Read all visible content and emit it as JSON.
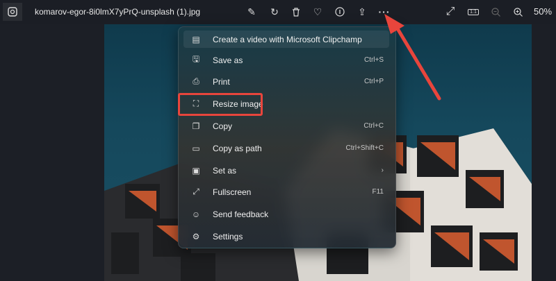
{
  "window": {
    "file_name": "komarov-egor-8i0lmX7yPrQ-unsplash (1).jpg",
    "zoom_level": "50%"
  },
  "toolbar": {
    "icons": [
      "edit-image-icon",
      "rotate-icon",
      "delete-icon",
      "favorite-icon",
      "info-icon",
      "share-icon",
      "more-icon",
      "fullscreen-icon",
      "actual-size-icon",
      "zoom-out-icon",
      "zoom-in-icon"
    ],
    "actual_size_label": "1:1"
  },
  "menu": {
    "items": [
      {
        "label": "Create a video with Microsoft Clipchamp",
        "shortcut": "",
        "icon": "clipchamp-icon"
      },
      {
        "label": "Save as",
        "shortcut": "Ctrl+S",
        "icon": "save-icon"
      },
      {
        "label": "Print",
        "shortcut": "Ctrl+P",
        "icon": "print-icon"
      },
      {
        "label": "Resize image",
        "shortcut": "",
        "icon": "resize-icon"
      },
      {
        "label": "Copy",
        "shortcut": "Ctrl+C",
        "icon": "copy-icon"
      },
      {
        "label": "Copy as path",
        "shortcut": "Ctrl+Shift+C",
        "icon": "copy-path-icon"
      },
      {
        "label": "Set as",
        "shortcut": "›",
        "icon": "set-as-icon"
      },
      {
        "label": "Fullscreen",
        "shortcut": "F11",
        "icon": "fullscreen-icon"
      },
      {
        "label": "Send feedback",
        "shortcut": "",
        "icon": "feedback-icon"
      },
      {
        "label": "Settings",
        "shortcut": "",
        "icon": "settings-icon"
      }
    ]
  },
  "colors": {
    "annotation": "#e8453c",
    "topbar": "#1b1e25"
  }
}
